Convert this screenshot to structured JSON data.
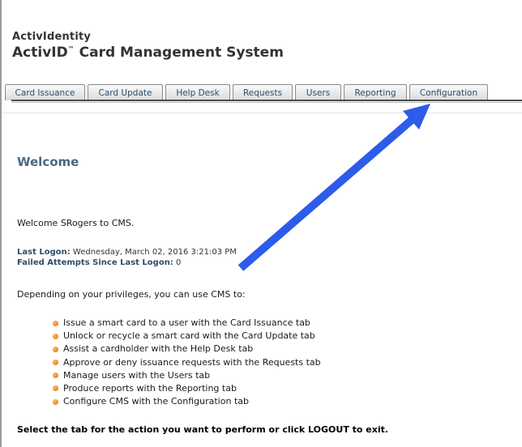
{
  "brand": {
    "company": "ActivIdentity",
    "product_prefix": "ActivID",
    "trademark": "™",
    "product_suffix": " Card Management System"
  },
  "tabs": [
    {
      "label": "Card Issuance"
    },
    {
      "label": "Card Update"
    },
    {
      "label": "Help Desk"
    },
    {
      "label": "Requests"
    },
    {
      "label": "Users"
    },
    {
      "label": "Reporting"
    },
    {
      "label": "Configuration"
    }
  ],
  "main": {
    "title": "Welcome",
    "welcome_message": "Welcome SRogers to CMS.",
    "last_logon_label": "Last Logon:",
    "last_logon_value": " Wednesday, March 02, 2016 3:21:03 PM",
    "failed_attempts_label": "Failed Attempts Since Last Logon:",
    "failed_attempts_value": " 0",
    "privileges_intro": "Depending on your privileges, you can use CMS to:",
    "bullets": [
      "Issue a smart card to a user with the Card Issuance tab",
      "Unlock or recycle a smart card with the Card Update tab",
      "Assist a cardholder with the Help Desk tab",
      "Approve or deny issuance requests with the Requests tab",
      "Manage users with the Users tab",
      "Produce reports with the Reporting tab",
      "Configure CMS with the Configuration tab"
    ],
    "instruction": "Select the tab for the action you want to perform or click LOGOUT to exit."
  },
  "colors": {
    "tab_text": "#2f4e6b",
    "title": "#4b6882",
    "bullet": "#f07d00",
    "arrow": "#2d5bea"
  }
}
